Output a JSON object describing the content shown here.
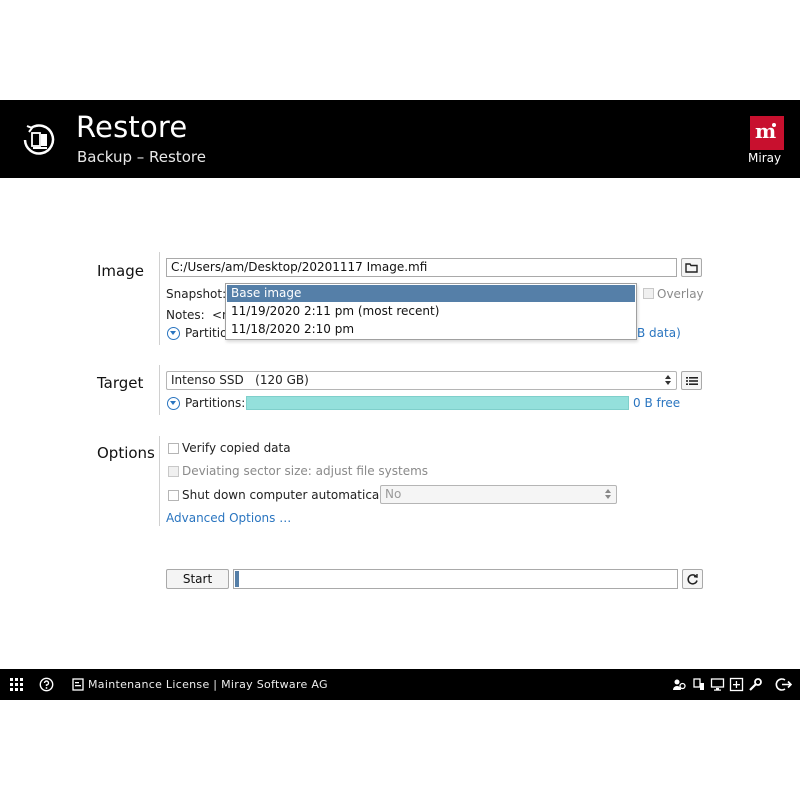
{
  "header": {
    "title": "Restore",
    "subtitle": "Backup – Restore",
    "brand": "Miray"
  },
  "image_section": {
    "label": "Image",
    "path_value": "C:/Users/am/Desktop/20201117 Image.mfi",
    "snapshot_label": "Snapshot:",
    "overlay_label": "Overlay",
    "notes_label": "Notes:",
    "notes_value": "<n",
    "partitions_label": "Partitio",
    "partitions_trail": "B data)",
    "snapshot_options": [
      "Base image",
      "11/19/2020 2:11 pm (most recent)",
      "11/18/2020 2:10 pm"
    ],
    "snapshot_selected": "Base image"
  },
  "target_section": {
    "label": "Target",
    "drive_value": "Intenso SSD   (120 GB)",
    "partitions_label": "Partitions:",
    "free_text": "0 B free"
  },
  "options_section": {
    "label": "Options",
    "verify_label": "Verify copied data",
    "deviating_label": "Deviating sector size: adjust file systems",
    "shutdown_label": "Shut down computer automatically:",
    "shutdown_value": "No",
    "advanced_link": "Advanced Options …"
  },
  "actions": {
    "start_label": "Start",
    "progress": 0.01
  },
  "footer": {
    "license_text": "Maintenance License | Miray Software AG"
  },
  "colors": {
    "header_bg": "#000000",
    "brand_red": "#c8102e",
    "link_blue": "#2a75c0",
    "selection_blue": "#557fa8",
    "partition_teal": "#94e0dc"
  }
}
